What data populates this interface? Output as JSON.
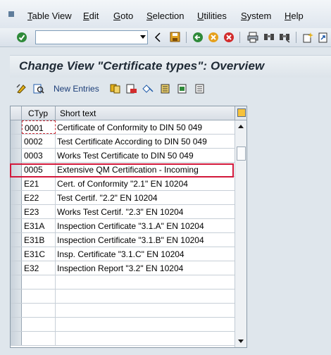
{
  "menu": {
    "items": [
      {
        "label": "Table View",
        "underline": "T",
        "rest": "able View"
      },
      {
        "label": "Edit",
        "underline": "E",
        "rest": "dit"
      },
      {
        "label": "Goto",
        "underline": "G",
        "rest": "oto"
      },
      {
        "label": "Selection",
        "underline": "S",
        "rest": "election"
      },
      {
        "label": "Utilities",
        "underline": "U",
        "rest": "tilities"
      },
      {
        "label": "System",
        "underline": "S",
        "rest": "ystem"
      },
      {
        "label": "Help",
        "underline": "H",
        "rest": "elp"
      }
    ]
  },
  "toolbar": {
    "command_field_value": "",
    "icons": [
      "enter-icon",
      "back-arrow-icon",
      "save-icon",
      "back-icon",
      "exit-icon",
      "cancel-icon",
      "print-icon",
      "find-icon",
      "find-next-icon",
      "new-session-icon",
      "shortcut-icon"
    ]
  },
  "title": "Change View \"Certificate types\": Overview",
  "app_toolbar": {
    "new_entries_label": "New Entries"
  },
  "table": {
    "headers": {
      "ctyp": "CTyp",
      "text": "Short text"
    },
    "rows": [
      {
        "ctyp": "0001",
        "text": "Certificate of Conformity to DIN 50 049"
      },
      {
        "ctyp": "0002",
        "text": "Test Certificate According to DIN 50 049"
      },
      {
        "ctyp": "0003",
        "text": "Works Test Certificate  to DIN 50 049"
      },
      {
        "ctyp": "0005",
        "text": "Extensive QM Certification - Incoming"
      },
      {
        "ctyp": "E21",
        "text": "Cert. of Conformity \"2.1\"   EN 10204"
      },
      {
        "ctyp": "E22",
        "text": "Test Certif. \"2.2\"        EN 10204"
      },
      {
        "ctyp": "E23",
        "text": "Works Test Certif. \"2.3\"   EN 10204"
      },
      {
        "ctyp": "E31A",
        "text": "Inspection Certificate \"3.1.A\"  EN 10204"
      },
      {
        "ctyp": "E31B",
        "text": "Inspection Certificate \"3.1.B\"  EN 10204"
      },
      {
        "ctyp": "E31C",
        "text": "Insp. Certificate \"3.1.C\"  EN 10204"
      },
      {
        "ctyp": "E32",
        "text": "Inspection Report \"3.2\"   EN 10204"
      },
      {
        "ctyp": "",
        "text": ""
      },
      {
        "ctyp": "",
        "text": ""
      },
      {
        "ctyp": "",
        "text": ""
      },
      {
        "ctyp": "",
        "text": ""
      },
      {
        "ctyp": "",
        "text": ""
      }
    ],
    "highlight_color": "#d2183b"
  }
}
